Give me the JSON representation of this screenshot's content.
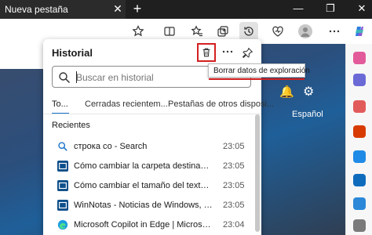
{
  "browser": {
    "tab_label": "Nueva pestaña",
    "tab_close": "✕",
    "new_tab": "+",
    "window_controls": {
      "minimize": "—",
      "maximize": "❐",
      "close": "✕"
    }
  },
  "toolbar": {
    "icons": [
      "favorite-star-icon",
      "split-screen-icon",
      "favorites-icon",
      "collections-icon",
      "history-icon",
      "browser-essentials-icon",
      "profile-avatar",
      "copilot-icon"
    ],
    "active": "history-icon"
  },
  "page": {
    "language": "Español"
  },
  "history": {
    "title": "Historial",
    "clear_tooltip": "Borrar datos de exploración",
    "search_placeholder": "Buscar en historial",
    "tabs": [
      "To...",
      "Cerradas recientem...",
      "Pestañas de otros disposi..."
    ],
    "section_label": "Recientes",
    "items": [
      {
        "icon": "search-icon",
        "title": "строка со - Search",
        "time": "23:05"
      },
      {
        "icon": "site-icon",
        "title": "Cómo cambiar la carpeta destinada para la de...",
        "time": "23:05"
      },
      {
        "icon": "site-icon",
        "title": "Cómo cambiar el tamaño del texto para los tít...",
        "time": "23:05"
      },
      {
        "icon": "site-icon",
        "title": "WinNotas - Noticias de Windows, reseñas de ...",
        "time": "23:05"
      },
      {
        "icon": "edge-icon",
        "title": "Microsoft Copilot in Edge | Microsoft Edge",
        "time": "23:04"
      }
    ]
  },
  "colors": {
    "accent": "#1a73c9",
    "highlight": "#d42020"
  }
}
